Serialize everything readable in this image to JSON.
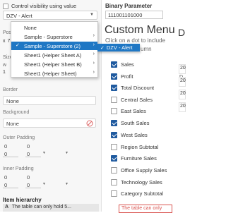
{
  "left_pane": {
    "control_visibility_label": "Control visibility using value",
    "control_visibility_value": "DZV - Alert",
    "position_label": "Posi",
    "position_x_label": "x",
    "position_x_value": "7",
    "size_label": "Size",
    "size_w_label": "w",
    "size_w_value": "1",
    "border_label": "Border",
    "border_value": "None",
    "background_label": "Background",
    "background_value": "None",
    "outer_padding_label": "Outer Padding",
    "outer_padding_values": [
      "0",
      "0",
      "0",
      "0"
    ],
    "inner_padding_label": "Inner Padding",
    "inner_padding_values": [
      "0",
      "0",
      "0",
      "0"
    ],
    "item_hierarchy_label": "Item hierarchy",
    "item_hierarchy_marker": "A",
    "item_hierarchy_text": "The table can only hold 5..."
  },
  "dropdown": {
    "items": [
      {
        "label": "None",
        "has_arrow": false
      },
      {
        "label": "Sample - Superstore",
        "has_arrow": true
      },
      {
        "label": "Sample - Superstore (2)",
        "has_arrow": true,
        "active": true
      },
      {
        "label": "Sheet1 (Helper Sheet A)",
        "has_arrow": true
      },
      {
        "label": "Sheet1 (Helper Sheet B)",
        "has_arrow": true
      },
      {
        "label": "Sheet1 (Helper Sheet)",
        "has_arrow": true
      }
    ],
    "submenu_item": "DZV - Alert"
  },
  "dashboard": {
    "parameter_title": "Binary Parameter",
    "parameter_value": "111001101000",
    "menu_title": "Custom Menu",
    "menu_subtitle_line1": "Click on a dot to include",
    "menu_subtitle_line2": "umn",
    "right_title": "D",
    "right_sub1": "O",
    "right_sub2": "D",
    "right_values": [
      "20",
      "20",
      "20",
      "20"
    ],
    "options": [
      {
        "label": "Sales",
        "checked": true
      },
      {
        "label": "Profit",
        "checked": true
      },
      {
        "label": "Total Discount",
        "checked": true
      },
      {
        "label": "Central Sales",
        "checked": false
      },
      {
        "label": "East Sales",
        "checked": false
      },
      {
        "label": "South Sales",
        "checked": true
      },
      {
        "label": "West Sales",
        "checked": true
      },
      {
        "label": "Region Subtotal",
        "checked": false
      },
      {
        "label": "Furniture Sales",
        "checked": true
      },
      {
        "label": "Office Supply Sales",
        "checked": false
      },
      {
        "label": "Technology Sales",
        "checked": false
      },
      {
        "label": "Category Subtotal",
        "checked": false
      }
    ],
    "toast_text": "The table can only"
  },
  "colors": {
    "accent": "#1f77c4",
    "checkbox_checked": "#1f5a9f",
    "warning": "#d9534f"
  }
}
